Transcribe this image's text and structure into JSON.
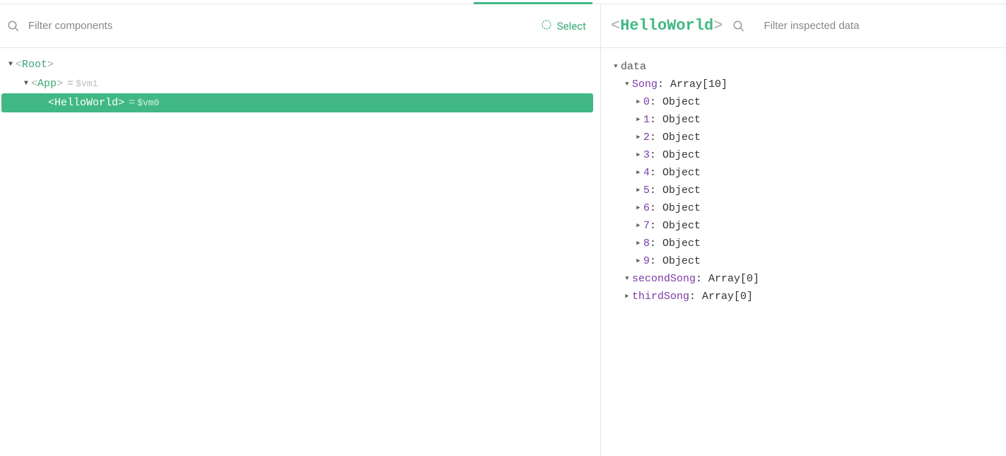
{
  "leftPanel": {
    "filterPlaceholder": "Filter components",
    "selectLabel": "Select",
    "tree": {
      "root": {
        "name": "Root"
      },
      "app": {
        "name": "App",
        "vm": "$vm1"
      },
      "helloWorld": {
        "name": "HelloWorld",
        "vm": "$vm0"
      }
    }
  },
  "rightPanel": {
    "selectedComponent": "HelloWorld",
    "filterPlaceholder": "Filter inspected data",
    "dataSectionLabel": "data",
    "song": {
      "key": "Song",
      "typeLabel": "Array[10]",
      "items": [
        {
          "key": "0",
          "value": "Object"
        },
        {
          "key": "1",
          "value": "Object"
        },
        {
          "key": "2",
          "value": "Object"
        },
        {
          "key": "3",
          "value": "Object"
        },
        {
          "key": "4",
          "value": "Object"
        },
        {
          "key": "5",
          "value": "Object"
        },
        {
          "key": "6",
          "value": "Object"
        },
        {
          "key": "7",
          "value": "Object"
        },
        {
          "key": "8",
          "value": "Object"
        },
        {
          "key": "9",
          "value": "Object"
        }
      ]
    },
    "secondSong": {
      "key": "secondSong",
      "typeLabel": "Array[0]"
    },
    "thirdSong": {
      "key": "thirdSong",
      "typeLabel": "Array[0]"
    }
  }
}
